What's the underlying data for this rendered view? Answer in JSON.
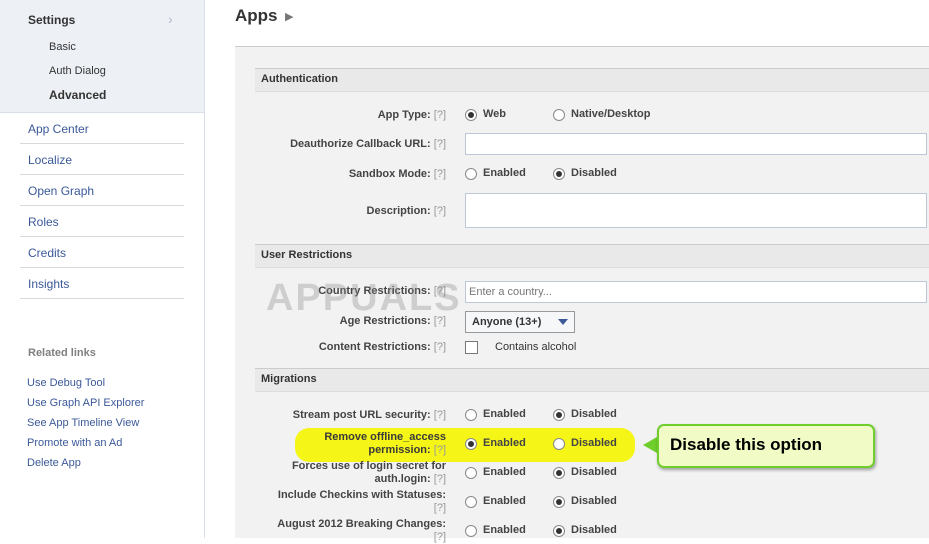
{
  "sidebar": {
    "settings_title": "Settings",
    "settings_sub": [
      "Basic",
      "Auth Dialog",
      "Advanced"
    ],
    "nav": [
      "App Center",
      "Localize",
      "Open Graph",
      "Roles",
      "Credits",
      "Insights"
    ],
    "related_title": "Related links",
    "related": [
      "Use Debug Tool",
      "Use Graph API Explorer",
      "See App Timeline View",
      "Promote with an Ad",
      "Delete App"
    ]
  },
  "header": {
    "title": "Apps"
  },
  "help": "[?]",
  "authentication": {
    "title": "Authentication",
    "app_type_label": "App Type:",
    "app_type_options": [
      "Web",
      "Native/Desktop"
    ],
    "deauth_label": "Deauthorize Callback URL:",
    "deauth_value": "",
    "sandbox_label": "Sandbox Mode:",
    "sandbox_options": [
      "Enabled",
      "Disabled"
    ],
    "description_label": "Description:",
    "description_value": ""
  },
  "user_restrictions": {
    "title": "User Restrictions",
    "country_label": "Country Restrictions:",
    "country_placeholder": "Enter a country...",
    "age_label": "Age Restrictions:",
    "age_value": "Anyone (13+)",
    "content_label": "Content Restrictions:",
    "content_checkbox": "Contains alcohol"
  },
  "migrations": {
    "title": "Migrations",
    "rows": [
      {
        "label": "Stream post URL security:",
        "enabled": "Enabled",
        "disabled": "Disabled",
        "selected": "disabled"
      },
      {
        "label1": "Remove offline_access",
        "label2": "permission:",
        "enabled": "Enabled",
        "disabled": "Disabled",
        "selected": "enabled"
      },
      {
        "label1": "Forces use of login secret for",
        "label2": "auth.login:",
        "enabled": "Enabled",
        "disabled": "Disabled",
        "selected": "disabled"
      },
      {
        "label": "Include Checkins with Statuses:",
        "enabled": "Enabled",
        "disabled": "Disabled",
        "selected": "disabled"
      },
      {
        "label": "August 2012 Breaking Changes:",
        "enabled": "Enabled",
        "disabled": "Disabled",
        "selected": "disabled"
      }
    ]
  },
  "callout": {
    "text": "Disable this option"
  },
  "watermark": "APPUALS"
}
